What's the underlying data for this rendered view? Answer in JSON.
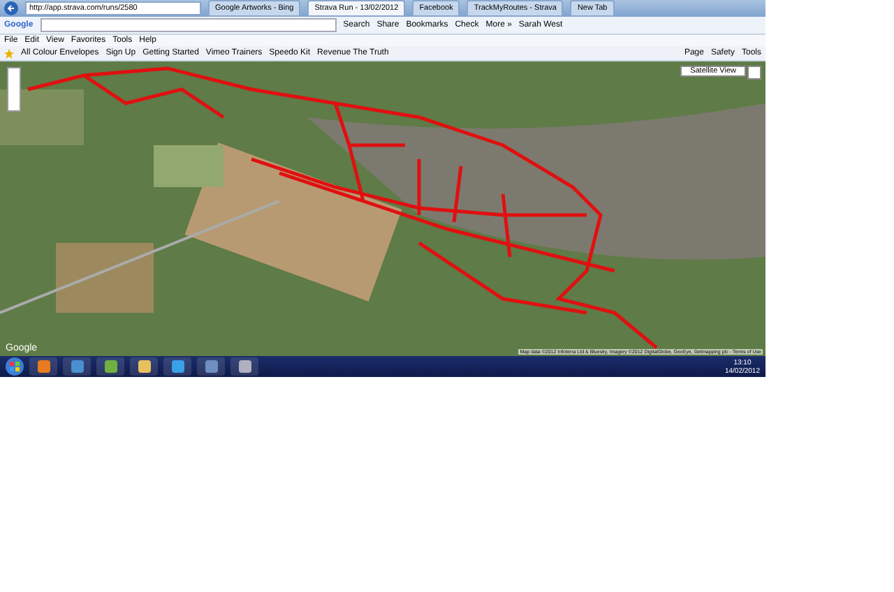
{
  "browser": {
    "address": "http://app.strava.com/runs/2580",
    "tabs": [
      {
        "label": "Google Artworks - Bing",
        "selected": false
      },
      {
        "label": "Strava Run - 13/02/2012",
        "selected": true
      },
      {
        "label": "Facebook",
        "selected": false
      },
      {
        "label": "TrackMyRoutes - Strava",
        "selected": false
      },
      {
        "label": "New Tab",
        "selected": false
      }
    ],
    "google_toolbar": {
      "logo": "Google",
      "items": [
        "Search",
        "Share",
        "Bookmarks",
        "Check",
        "More »",
        "Sarah West"
      ]
    },
    "menu": [
      "File",
      "Edit",
      "View",
      "Favorites",
      "Tools",
      "Help"
    ],
    "favorites": [
      "All Colour Envelopes",
      "Sign Up",
      "Getting Started",
      "Vimeo Trainers",
      "Speedo Kit",
      "Revenue The Truth"
    ],
    "command_bar": [
      "Page",
      "Safety",
      "Tools"
    ]
  },
  "map": {
    "view_select": "Satellite View",
    "logo": "Google",
    "attribution": "Map data ©2012 Infoterra Ltd & Bluesky, Imagery ©2012 DigitalGlobe, GeoEye, Getmapping plc - Terms of Use"
  },
  "taskbar": {
    "time": "13:10",
    "date": "14/02/2012"
  }
}
